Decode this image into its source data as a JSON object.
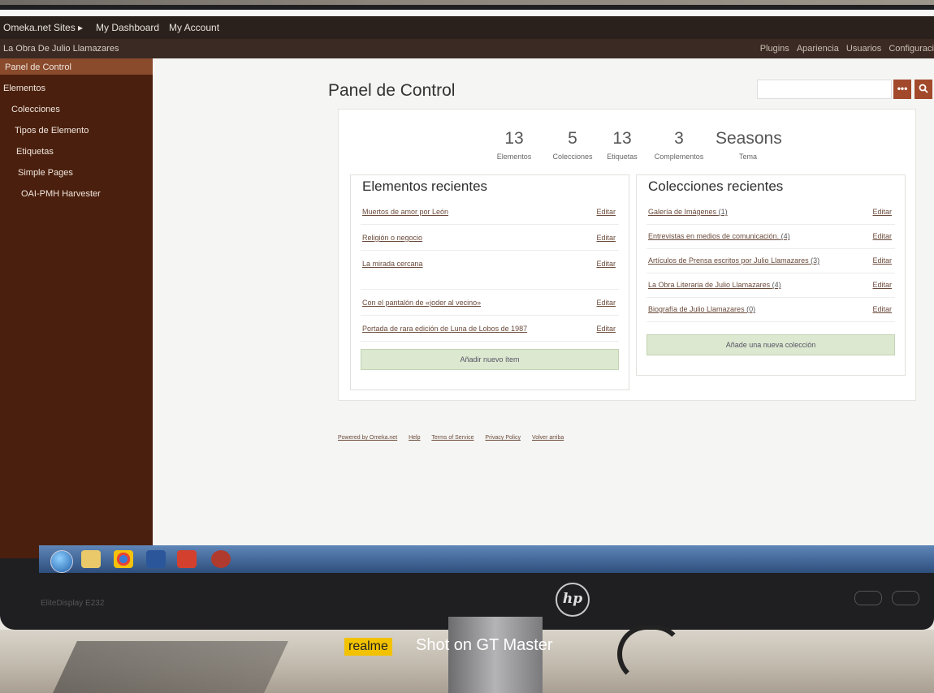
{
  "topbar": {
    "sites": "Omeka.net Sites ▸",
    "dashboard": "My Dashboard",
    "account": "My Account"
  },
  "site": {
    "name": "La Obra De Julio Llamazares",
    "nav": [
      "Plugins",
      "Apariencia",
      "Usuarios",
      "Configuraci"
    ]
  },
  "sidebar": {
    "items": [
      "Panel de Control",
      "Elementos",
      "Colecciones",
      "Tipos de Elemento",
      "Etiquetas",
      "Simple Pages",
      "OAI-PMH Harvester"
    ]
  },
  "page": {
    "title": "Panel de Control",
    "more_btn": "•••",
    "search_icon": "search-icon"
  },
  "stats": [
    {
      "value": "13",
      "label": "Elementos"
    },
    {
      "value": "5",
      "label": "Colecciones"
    },
    {
      "value": "13",
      "label": "Etiquetas"
    },
    {
      "value": "3",
      "label": "Complementos"
    },
    {
      "value": "Seasons",
      "label": "Tema"
    }
  ],
  "recent_items": {
    "title": "Elementos recientes",
    "items": [
      {
        "label": "Muertos de amor por León",
        "edit": "Editar"
      },
      {
        "label": "Religión o negocio",
        "edit": "Editar"
      },
      {
        "label": "La mirada cercana",
        "edit": "Editar"
      },
      {
        "label": "Con el pantalón de «joder al vecino»",
        "edit": "Editar"
      },
      {
        "label": "Portada de rara edición de Luna de Lobos de 1987",
        "edit": "Editar"
      }
    ],
    "add": "Añadir nuevo ítem"
  },
  "recent_collections": {
    "title": "Colecciones recientes",
    "items": [
      {
        "label": "Galería de Imágenes",
        "count": "(1)",
        "edit": "Editar"
      },
      {
        "label": "Entrevistas en medios de comunicación.",
        "count": "(4)",
        "edit": "Editar"
      },
      {
        "label": "Artículos de Prensa escritos por Julio Llamazares",
        "count": "(3)",
        "edit": "Editar"
      },
      {
        "label": "La Obra Literaria de Julio Llamazares",
        "count": "(4)",
        "edit": "Editar"
      },
      {
        "label": "Biografía de Julio Llamazares",
        "count": "(0)",
        "edit": "Editar"
      }
    ],
    "add": "Añade una nueva colección"
  },
  "footer": [
    "Powered by Omeka.net",
    "Help",
    "Terms of Service",
    "Privacy Policy",
    "Volver arriba"
  ],
  "monitor": {
    "model": "EliteDisplay E232",
    "brand": "hp"
  },
  "watermark": {
    "brand": "realme",
    "text": "Shot on GT Master"
  }
}
